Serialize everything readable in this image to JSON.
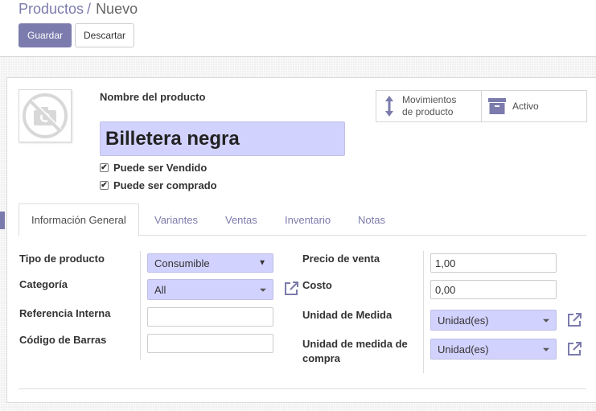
{
  "breadcrumb": {
    "parent": "Productos",
    "separator": "/",
    "current": "Nuevo"
  },
  "toolbar": {
    "save_label": "Guardar",
    "discard_label": "Descartar"
  },
  "colors": {
    "primary": "#7c7bad",
    "required_field_bg": "#d2d2ff"
  },
  "product": {
    "name_label": "Nombre del producto",
    "name_value": "Billetera negra",
    "can_be_sold_label": "Puede ser Vendido",
    "can_be_sold_checked": true,
    "can_be_purchased_label": "Puede ser comprado",
    "can_be_purchased_checked": true,
    "image_icon": "camera-slash-icon"
  },
  "smart_buttons": {
    "moves_line1": "Movimientos",
    "moves_line2": "de producto",
    "moves_icon": "vertical-arrows-icon",
    "active_label": "Activo",
    "active_icon": "archive-box-icon"
  },
  "tabs": [
    {
      "label": "Información General",
      "active": true
    },
    {
      "label": "Variantes",
      "active": false
    },
    {
      "label": "Ventas",
      "active": false
    },
    {
      "label": "Inventario",
      "active": false
    },
    {
      "label": "Notas",
      "active": false
    }
  ],
  "general_info": {
    "product_type_label": "Tipo de producto",
    "product_type_value": "Consumible",
    "category_label": "Categoría",
    "category_value": "All",
    "internal_ref_label": "Referencia Interna",
    "internal_ref_value": "",
    "barcode_label": "Código de Barras",
    "barcode_value": "",
    "sale_price_label": "Precio de venta",
    "sale_price_value": "1,00",
    "cost_label": "Costo",
    "cost_value": "0,00",
    "uom_label": "Unidad de Medida",
    "uom_value": "Unidad(es)",
    "purchase_uom_label_line1": "Unidad de medida de",
    "purchase_uom_label_line2": "compra",
    "purchase_uom_value": "Unidad(es)"
  }
}
